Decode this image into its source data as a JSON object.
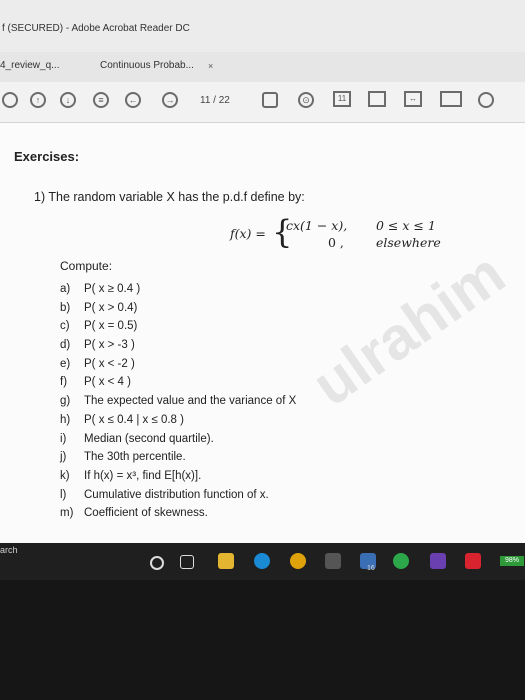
{
  "window": {
    "title": "f (SECURED) - Adobe Acrobat Reader DC"
  },
  "tabs": [
    {
      "label": "4_review_q..."
    },
    {
      "label": "Continuous Probab..."
    }
  ],
  "tab_close": "×",
  "toolbar": {
    "page_current": "11",
    "page_total": "/ 22"
  },
  "document": {
    "heading": "Exercises:",
    "question": "1)  The random variable X has the p.d.f define by:",
    "formula": {
      "lhs": "f(x) =",
      "case1_expr": "cx(1 − x),",
      "case2_expr": "0 ,",
      "case1_domain": "0 ≤ x ≤ 1",
      "case2_domain": "elsewhere"
    },
    "compute_label": "Compute:",
    "items": [
      {
        "label": "a)",
        "text": "P( x ≥ 0.4 )"
      },
      {
        "label": "b)",
        "text": "P( x > 0.4)"
      },
      {
        "label": "c)",
        "text": "P( x = 0.5)"
      },
      {
        "label": "d)",
        "text": "P( x > -3 )"
      },
      {
        "label": "e)",
        "text": "P( x < -2 )"
      },
      {
        "label": "f)",
        "text": "P( x < 4 )"
      },
      {
        "label": "g)",
        "text": "The expected value and the variance of X"
      },
      {
        "label": "h)",
        "text": "P( x ≤ 0.4 | x ≤ 0.8 )"
      },
      {
        "label": "i)",
        "text": "Median (second quartile)."
      },
      {
        "label": "j)",
        "text": "The 30th percentile."
      },
      {
        "label": "k)",
        "text": "If h(x) = x³, find E[h(x)]."
      },
      {
        "label": "l)",
        "text": "Cumulative distribution function of x."
      },
      {
        "label": "m)",
        "text": "Coefficient of skewness."
      }
    ],
    "watermark": "ulrahim"
  },
  "taskbar": {
    "search": "arch",
    "badge": "16",
    "battery": "98%"
  },
  "colors": {
    "battery": "#2e9a3a",
    "taskbar": "#1f1f1f",
    "acrobat": "#d9232e"
  }
}
